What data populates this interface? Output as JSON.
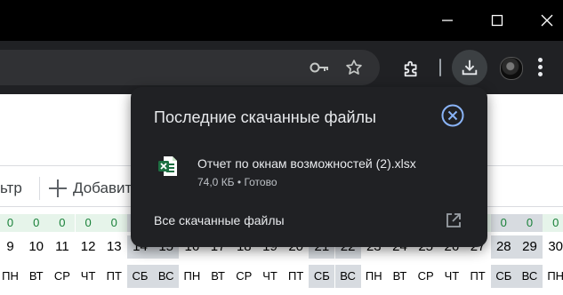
{
  "downloads": {
    "title": "Последние скачанные файлы",
    "item": {
      "name": "Отчет по окнам возможностей (2).xlsx",
      "size": "74,0 КБ",
      "separator": " • ",
      "status": "Готово"
    },
    "all_downloads_label": "Все скачанные файлы"
  },
  "page": {
    "filter_label": "ьтр",
    "add_label": "Добавит",
    "zero_row": [
      {
        "v": "0",
        "weekend": false
      },
      {
        "v": "0",
        "weekend": false
      },
      {
        "v": "0",
        "weekend": false
      },
      {
        "v": "0",
        "weekend": false
      },
      {
        "v": "0",
        "weekend": false
      },
      {
        "v": "0",
        "weekend": true
      },
      {
        "v": "0",
        "weekend": true
      },
      {
        "v": "0",
        "weekend": false
      },
      {
        "v": "0",
        "weekend": false
      },
      {
        "v": "0",
        "weekend": false
      },
      {
        "v": "0",
        "weekend": false
      },
      {
        "v": "0",
        "weekend": false
      },
      {
        "v": "0",
        "weekend": true
      },
      {
        "v": "0",
        "weekend": true
      },
      {
        "v": "0",
        "weekend": false
      },
      {
        "v": "0",
        "weekend": false
      },
      {
        "v": "0",
        "weekend": false
      },
      {
        "v": "0",
        "weekend": false
      },
      {
        "v": "0",
        "weekend": false
      },
      {
        "v": "0",
        "weekend": true
      },
      {
        "v": "0",
        "weekend": true
      },
      {
        "v": "0",
        "weekend": false
      }
    ],
    "day_numbers": [
      "9",
      "10",
      "11",
      "12",
      "13",
      "14",
      "15",
      "16",
      "17",
      "18",
      "19",
      "20",
      "21",
      "22",
      "23",
      "24",
      "25",
      "26",
      "27",
      "28",
      "29",
      "30"
    ],
    "weekdays": [
      "ПН",
      "ВТ",
      "СР",
      "ЧТ",
      "ПТ",
      "СБ",
      "ВС",
      "ПН",
      "ВТ",
      "СР",
      "ЧТ",
      "ПТ",
      "СБ",
      "ВС",
      "ПН",
      "ВТ",
      "СР",
      "ЧТ",
      "ПТ",
      "СБ",
      "ВС",
      "ПН"
    ],
    "weekend_color": "#d7dbe0",
    "zero_color": "#e6f4ea"
  },
  "icons": {
    "password": "key-icon",
    "bookmark": "star-icon",
    "extensions": "puzzle-icon",
    "downloads": "download-icon",
    "profile": "avatar",
    "menu": "kebab-menu-icon",
    "file": "excel-file-icon",
    "close": "close-circle-icon",
    "open_folder": "open-external-icon"
  },
  "colors": {
    "chrome_bg": "#202124",
    "bubble_bg": "#202124",
    "accent": "#8ab4f8",
    "excel_green": "#1d6f42"
  }
}
